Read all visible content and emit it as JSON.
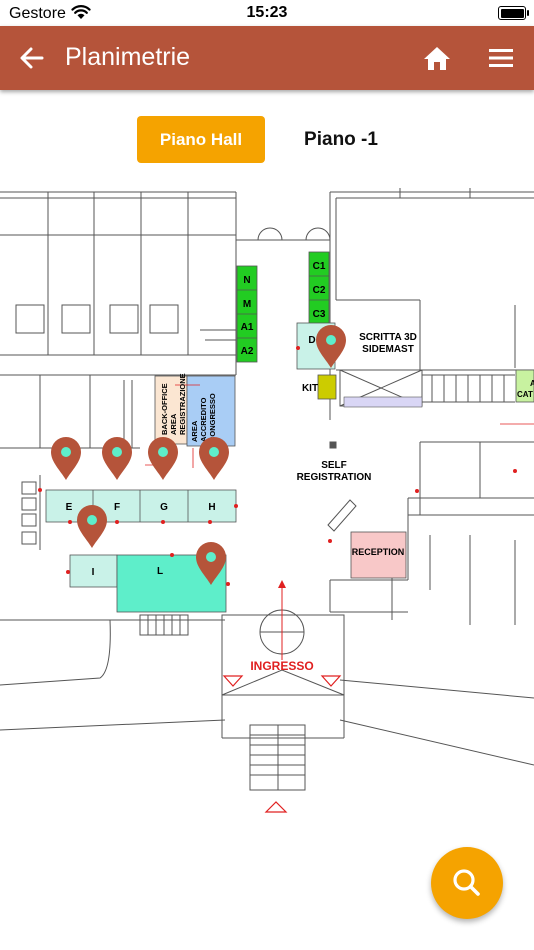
{
  "status_bar": {
    "carrier": "Gestore",
    "time": "15:23"
  },
  "header": {
    "title": "Planimetrie"
  },
  "floor_tabs": [
    {
      "label": "Piano Hall",
      "selected": true
    },
    {
      "label": "Piano -1",
      "selected": false
    }
  ],
  "map": {
    "green_booths": [
      "N",
      "M",
      "A1",
      "A2",
      "C1",
      "C2",
      "C3"
    ],
    "stands_top": [
      "E",
      "F",
      "G",
      "H"
    ],
    "stands_bottom": [
      "I",
      "L"
    ],
    "labels": {
      "d": "D",
      "kit": "KIT",
      "scritta_line1": "SCRITTA 3D",
      "scritta_line2": "SIDEMAST",
      "back_office_1": "BACK-OFFICE",
      "back_office_2": "AREA",
      "back_office_3": "REGISTRAZIONE",
      "accredito_1": "AREA",
      "accredito_2": "ACCREDITO",
      "accredito_3": "CONGRESSO",
      "self_1": "SELF",
      "self_2": "REGISTRATION",
      "reception": "RECEPTION",
      "ingresso": "INGRESSO",
      "edge_a": "A",
      "edge_cat": "CAT"
    }
  },
  "colors": {
    "app_bar": "#b5543a",
    "accent": "#f5a300",
    "pin": "#b5543a",
    "booth_green": "#22cc22",
    "booth_teal": "#c9f2e8",
    "accredito_blue": "#a9cdf5",
    "reception_pink": "#f8c8c8",
    "back_office_peach": "#fbe6d2",
    "ingresso_red": "#e02020"
  },
  "icons": {
    "back": "arrow-left-icon",
    "home": "home-icon",
    "menu": "menu-icon",
    "search": "search-icon",
    "pin": "map-pin-icon"
  }
}
